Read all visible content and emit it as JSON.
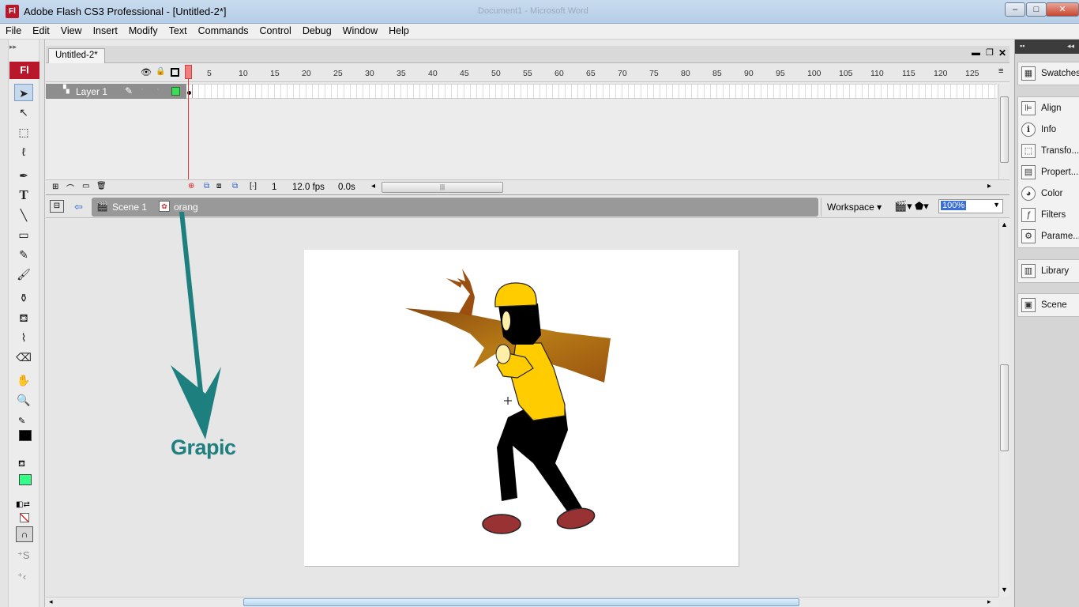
{
  "window": {
    "title": "Adobe Flash CS3 Professional - [Untitled-2*]",
    "background_app_title": "Document1 - Microsoft Word",
    "icon_label": "Fl",
    "minimize": "–",
    "maximize": "□",
    "close": "✕"
  },
  "menu": [
    "File",
    "Edit",
    "View",
    "Insert",
    "Modify",
    "Text",
    "Commands",
    "Control",
    "Debug",
    "Window",
    "Help"
  ],
  "toolbar": {
    "logo": "Fl",
    "tools": [
      {
        "name": "selection-tool",
        "glyph": "➤",
        "selected": true
      },
      {
        "name": "subselection-tool",
        "glyph": "↖"
      },
      {
        "name": "free-transform-tool",
        "glyph": "⬚"
      },
      {
        "name": "lasso-tool",
        "glyph": "ℓ"
      },
      {
        "name": "pen-tool",
        "glyph": "✒"
      },
      {
        "name": "text-tool",
        "glyph": "T"
      },
      {
        "name": "line-tool",
        "glyph": "╲"
      },
      {
        "name": "rectangle-tool",
        "glyph": "▭"
      },
      {
        "name": "pencil-tool",
        "glyph": "✎"
      },
      {
        "name": "brush-tool",
        "glyph": "🖌"
      },
      {
        "name": "ink-bottle-tool",
        "glyph": "⚱"
      },
      {
        "name": "paint-bucket-tool",
        "glyph": "⛾"
      },
      {
        "name": "eyedropper-tool",
        "glyph": "⌇"
      },
      {
        "name": "eraser-tool",
        "glyph": "⌫"
      },
      {
        "name": "hand-tool",
        "glyph": "✋"
      },
      {
        "name": "zoom-tool",
        "glyph": "🔍"
      }
    ],
    "stroke_color": "#000000",
    "fill_color": "#33ff88"
  },
  "document": {
    "tab": "Untitled-2*"
  },
  "timeline": {
    "frame_numbers": [
      "5",
      "10",
      "15",
      "20",
      "25",
      "30",
      "35",
      "40",
      "45",
      "50",
      "55",
      "60",
      "65",
      "70",
      "75",
      "80",
      "85",
      "90",
      "95",
      "100",
      "105",
      "110",
      "115",
      "120",
      "125"
    ],
    "layer_name": "Layer 1",
    "current_frame": "1",
    "frame_rate": "12.0 fps",
    "elapsed": "0.0s"
  },
  "editbar": {
    "scene": "Scene 1",
    "symbol": "orang",
    "workspace": "Workspace",
    "zoom": "100%"
  },
  "annotation": {
    "label": "Grapic",
    "color": "#1e7f7f"
  },
  "panels": [
    {
      "group": 1,
      "label": "Swatches",
      "icon": "swatches-icon",
      "glyph": "▦"
    },
    {
      "group": 2,
      "label": "Align",
      "icon": "align-icon",
      "glyph": "⊫"
    },
    {
      "group": 2,
      "label": "Info",
      "icon": "info-icon",
      "glyph": "ℹ"
    },
    {
      "group": 2,
      "label": "Transfo...",
      "icon": "transform-icon",
      "glyph": "⬚"
    },
    {
      "group": 2,
      "label": "Propert...",
      "icon": "properties-icon",
      "glyph": "▤"
    },
    {
      "group": 2,
      "label": "Color",
      "icon": "color-icon",
      "glyph": "◕"
    },
    {
      "group": 2,
      "label": "Filters",
      "icon": "filters-icon",
      "glyph": "ƒ"
    },
    {
      "group": 2,
      "label": "Parame...",
      "icon": "parameters-icon",
      "glyph": "⚙"
    },
    {
      "group": 3,
      "label": "Library",
      "icon": "library-icon",
      "glyph": "▥"
    },
    {
      "group": 4,
      "label": "Scene",
      "icon": "scene-icon",
      "glyph": "▣"
    }
  ]
}
